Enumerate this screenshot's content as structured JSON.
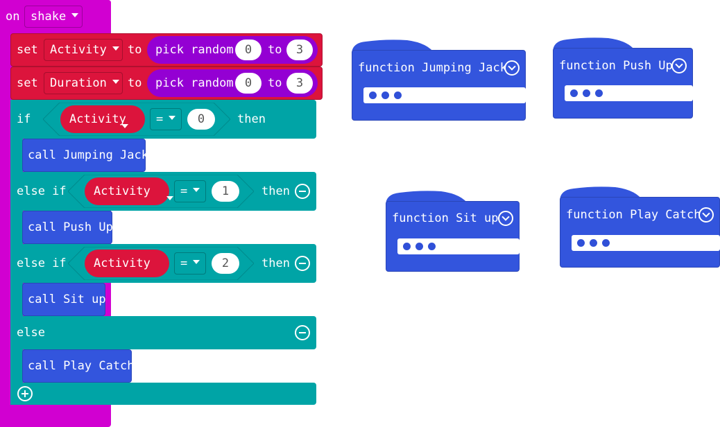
{
  "colors": {
    "event": "#d100d1",
    "variable": "#dc143c",
    "math": "#9400d3",
    "logic": "#00a4a6",
    "function": "#3355dd"
  },
  "event_block": {
    "label": "on",
    "dropdown": "shake"
  },
  "set_blocks": [
    {
      "label": "set",
      "variable": "Activity",
      "to": "to",
      "random_label": "pick random",
      "min": "0",
      "and": "to",
      "max": "3"
    },
    {
      "label": "set",
      "variable": "Duration",
      "to": "to",
      "random_label": "pick random",
      "min": "0",
      "and": "to",
      "max": "3"
    }
  ],
  "if_block": {
    "if_label": "if",
    "else_if_label": "else if",
    "else_label": "else",
    "then_label": "then",
    "operator": "=",
    "conditions": [
      {
        "variable": "Activity",
        "value": "0"
      },
      {
        "variable": "Activity",
        "value": "1"
      },
      {
        "variable": "Activity",
        "value": "2"
      }
    ],
    "calls": [
      "call Jumping Jack",
      "call Push Up",
      "call Sit up",
      "call Play Catch"
    ],
    "icons": {
      "remove": "minus-circle-icon",
      "add": "plus-circle-icon"
    }
  },
  "functions": [
    {
      "title": "function Jumping Jack"
    },
    {
      "title": "function Push Up"
    },
    {
      "title": "function Sit up"
    },
    {
      "title": "function Play Catch"
    }
  ]
}
